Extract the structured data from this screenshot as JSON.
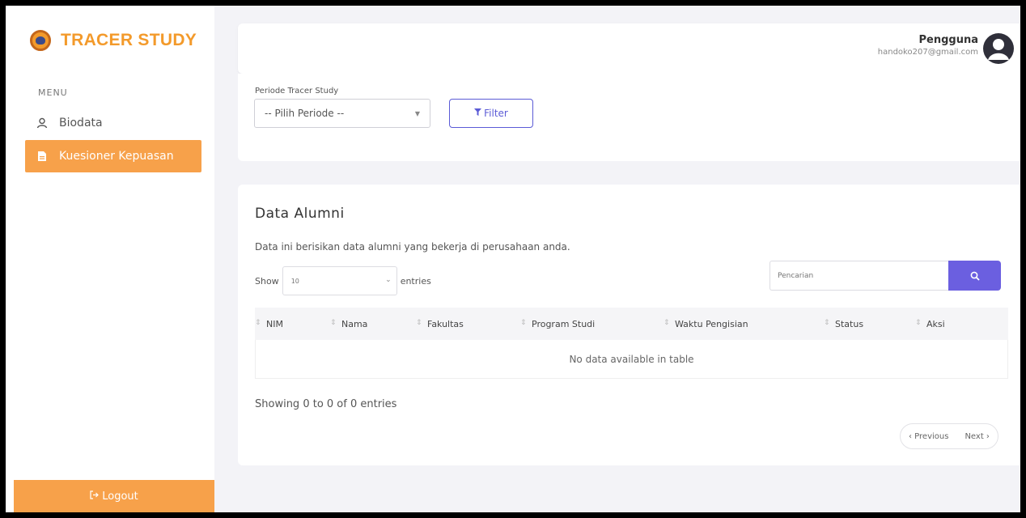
{
  "app": {
    "brand": "TRACER STUDY"
  },
  "sidebar": {
    "menu_label": "MENU",
    "items": [
      {
        "label": "Biodata",
        "icon": "user-icon",
        "active": false
      },
      {
        "label": "Kuesioner Kepuasan",
        "icon": "document-icon",
        "active": true
      }
    ],
    "logout_label": "Logout"
  },
  "header": {
    "user_role": "Pengguna",
    "user_email": "handoko207@gmail.com"
  },
  "filter": {
    "period_label": "Periode Tracer Study",
    "period_value": "-- Pilih Periode --",
    "filter_button": "Filter"
  },
  "data_card": {
    "title": "Data Alumni",
    "description": "Data ini berisikan data alumni yang bekerja di perusahaan anda.",
    "show_label": "Show",
    "entries_value": "10",
    "entries_label": "entries",
    "search_placeholder": "Pencarian",
    "columns": [
      "NIM",
      "Nama",
      "Fakultas",
      "Program Studi",
      "Waktu Pengisian",
      "Status",
      "Aksi"
    ],
    "empty_message": "No data available in table",
    "showing_text": "Showing 0 to 0 of 0 entries",
    "prev_label": "‹ Previous",
    "next_label": "Next ›"
  },
  "colors": {
    "accent_orange": "#f7a14a",
    "accent_purple": "#6b5fe0",
    "filter_border": "#5b5bd6"
  }
}
